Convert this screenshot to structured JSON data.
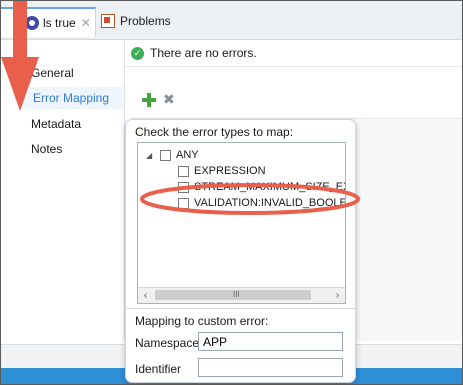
{
  "tabs": [
    {
      "label": "ls true"
    },
    {
      "label": "Problems"
    }
  ],
  "nav": {
    "items": [
      {
        "label": "General"
      },
      {
        "label": "Error Mapping"
      },
      {
        "label": "Metadata"
      },
      {
        "label": "Notes"
      }
    ]
  },
  "status": {
    "text": "There are no errors."
  },
  "popup": {
    "title": "Check the error types to map:",
    "tree": [
      {
        "label": "ANY"
      },
      {
        "label": "EXPRESSION"
      },
      {
        "label": "STREAM_MAXIMUM_SIZE_EXCE"
      },
      {
        "label": "VALIDATION:INVALID_BOOLEA"
      }
    ],
    "scroll_grip": "III",
    "mapping_title": "Mapping to custom error:",
    "namespace_label": "Namespace",
    "namespace_value": "APP",
    "identifier_label": "Identifier",
    "identifier_value": ""
  },
  "colors": {
    "accent": "#2c7be0",
    "annotation_red": "#e8604c",
    "status_ok": "#3fae5b"
  }
}
